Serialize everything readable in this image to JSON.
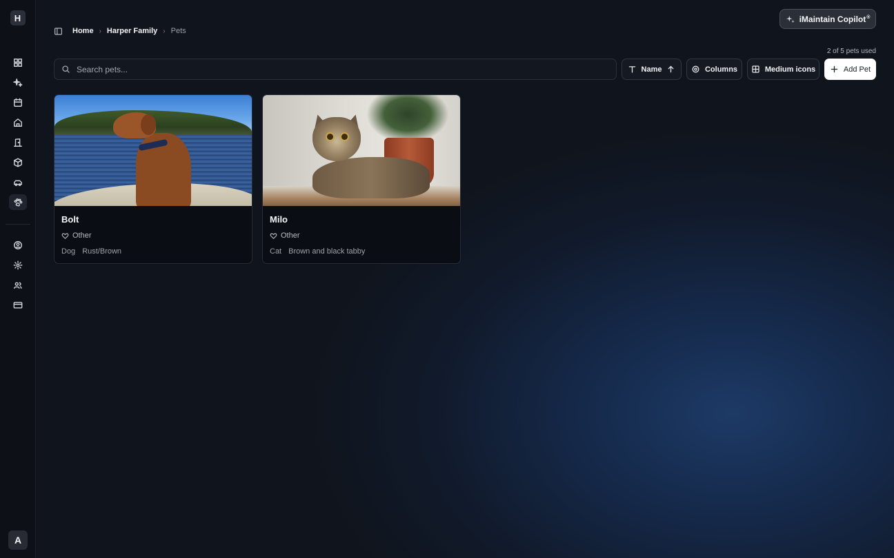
{
  "app": {
    "logo_letter": "H",
    "user_initial": "A"
  },
  "sidebar": {
    "items": [
      {
        "name": "dashboard",
        "icon": "dashboard-grid-icon"
      },
      {
        "name": "copilot",
        "icon": "sparkles-icon"
      },
      {
        "name": "calendar",
        "icon": "calendar-icon"
      },
      {
        "name": "home",
        "icon": "home-icon"
      },
      {
        "name": "rooms",
        "icon": "door-icon"
      },
      {
        "name": "items",
        "icon": "box-icon"
      },
      {
        "name": "vehicles",
        "icon": "car-icon"
      },
      {
        "name": "pets",
        "icon": "paw-icon",
        "active": true
      }
    ],
    "secondary_items": [
      {
        "name": "profile",
        "icon": "user-circle-icon"
      },
      {
        "name": "settings",
        "icon": "gear-icon"
      },
      {
        "name": "members",
        "icon": "users-icon"
      },
      {
        "name": "billing",
        "icon": "credit-card-icon"
      }
    ]
  },
  "header": {
    "copilot_label": "iMaintain Copilot",
    "copilot_mark": "®"
  },
  "breadcrumb": {
    "home": "Home",
    "family": "Harper Family",
    "current": "Pets"
  },
  "toolbar": {
    "usage": "2 of 5 pets used",
    "search_placeholder": "Search pets...",
    "sort_label": "Name",
    "columns_label": "Columns",
    "view_label": "Medium icons",
    "add_label": "Add Pet"
  },
  "pets": [
    {
      "name": "Bolt",
      "relation": "Other",
      "species": "Dog",
      "color": "Rust/Brown"
    },
    {
      "name": "Milo",
      "relation": "Other",
      "species": "Cat",
      "color": "Brown and black tabby"
    }
  ],
  "colors": {
    "background": "#10141c",
    "accent_glow": "#1d3a66",
    "primary_button": "#ffffff"
  }
}
